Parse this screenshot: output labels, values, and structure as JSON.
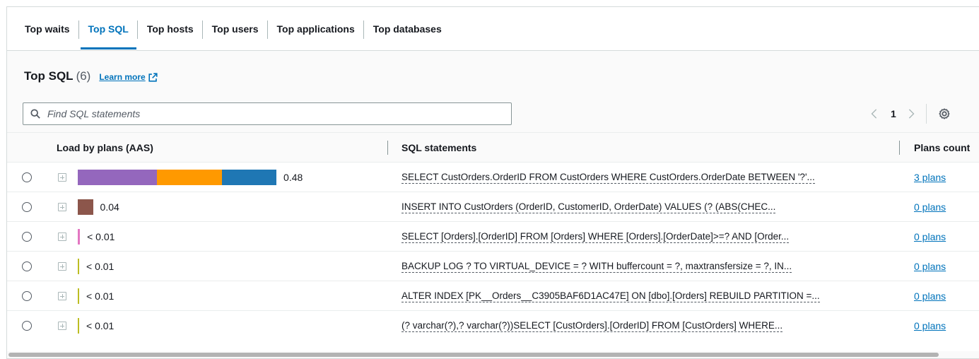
{
  "tabs": [
    {
      "label": "Top waits"
    },
    {
      "label": "Top SQL"
    },
    {
      "label": "Top hosts"
    },
    {
      "label": "Top users"
    },
    {
      "label": "Top applications"
    },
    {
      "label": "Top databases"
    }
  ],
  "active_tab": "Top SQL",
  "section": {
    "title": "Top SQL",
    "count": "(6)",
    "learn_more": "Learn more"
  },
  "search": {
    "placeholder": "Find SQL statements",
    "value": ""
  },
  "pagination": {
    "current_page": "1"
  },
  "table": {
    "columns": [
      "Load by plans (AAS)",
      "SQL statements",
      "Plans count"
    ],
    "rows": [
      {
        "load": "0.48",
        "load_segments": [
          {
            "fraction": 0.145,
            "color": "#9467bd"
          },
          {
            "fraction": 0.12,
            "color": "#ff9900"
          },
          {
            "fraction": 0.1,
            "color": "#1f77b4"
          }
        ],
        "sql": "SELECT CustOrders.OrderID FROM CustOrders WHERE CustOrders.OrderDate BETWEEN '?'...",
        "plans": "3 plans"
      },
      {
        "load": "0.04",
        "load_segments": [
          {
            "fraction": 0.028,
            "color": "#8c564b"
          }
        ],
        "sql": "INSERT INTO CustOrders (OrderID, CustomerID, OrderDate) VALUES (? (ABS(CHEC...",
        "plans": "0 plans"
      },
      {
        "load": "< 0.01",
        "load_segments": [
          {
            "fraction": 0.004,
            "color": "#e377c2"
          }
        ],
        "sql": "SELECT [Orders].[OrderID] FROM [Orders] WHERE [Orders].[OrderDate]>=? AND [Order...",
        "plans": "0 plans"
      },
      {
        "load": "< 0.01",
        "load_segments": [
          {
            "fraction": 0.0015,
            "color": "#bcbd22"
          }
        ],
        "sql": "BACKUP LOG ? TO VIRTUAL_DEVICE = ? WITH buffercount = ?, maxtransfersize = ?, IN...",
        "plans": "0 plans"
      },
      {
        "load": "< 0.01",
        "load_segments": [
          {
            "fraction": 0.0015,
            "color": "#bcbd22"
          }
        ],
        "sql": "ALTER INDEX [PK__Orders__C3905BAF6D1AC47E] ON [dbo].[Orders] REBUILD PARTITION =...",
        "plans": "0 plans"
      },
      {
        "load": "< 0.01",
        "load_segments": [
          {
            "fraction": 0.0015,
            "color": "#bcbd22"
          }
        ],
        "sql": "(? varchar(?),? varchar(?))SELECT [CustOrders].[OrderID] FROM [CustOrders] WHERE...",
        "plans": "0 plans"
      }
    ]
  },
  "colors": {
    "accent": "#0073bb",
    "text": "#16191f",
    "border": "#d5dbdb"
  }
}
